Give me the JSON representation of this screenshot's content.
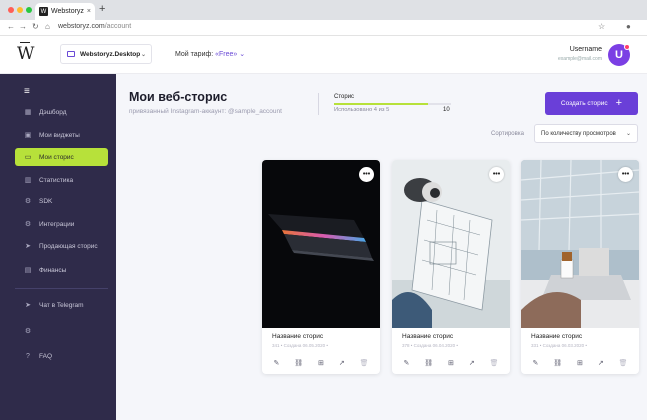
{
  "browser": {
    "tab_title": "Webstoryz",
    "tab_icon": "W",
    "tab_close": "×",
    "new_tab": "+",
    "url_domain": "webstoryz.com",
    "url_path": "/account",
    "traffic_lights": [
      "#ff5f57",
      "#febc2e",
      "#28c840"
    ]
  },
  "header": {
    "logo": "W",
    "project": "Webstoryz.Desktop",
    "plan_label": "Мой тариф:",
    "plan_value": "«Free»",
    "username": "Username",
    "email": "example@mail.com",
    "avatar_letter": "U"
  },
  "sidebar": {
    "items": [
      {
        "label": "Дэшборд",
        "icon": "grid-icon",
        "glyph": "▦",
        "active": false
      },
      {
        "label": "Мои виджеты",
        "icon": "widgets-icon",
        "glyph": "▣",
        "active": false
      },
      {
        "label": "Мои сторис",
        "icon": "stories-icon",
        "glyph": "▭",
        "active": true
      },
      {
        "label": "Статистика",
        "icon": "chart-icon",
        "glyph": "▥",
        "active": false
      },
      {
        "label": "SDK",
        "icon": "sdk-icon",
        "glyph": "⚙",
        "active": false
      },
      {
        "label": "Интеграции",
        "icon": "integrations-icon",
        "glyph": "⚙",
        "active": false
      },
      {
        "label": "Продающая сторис",
        "icon": "sell-icon",
        "glyph": "➤",
        "active": false
      },
      {
        "label": "Финансы",
        "icon": "finance-icon",
        "glyph": "▤",
        "active": false
      }
    ],
    "bottom_items": [
      {
        "label": "Чат в Telegram",
        "icon": "telegram-icon",
        "glyph": "➤"
      },
      {
        "label": "",
        "icon": "settings-icon",
        "glyph": "⚙"
      },
      {
        "label": "FAQ",
        "icon": "help-icon",
        "glyph": "?"
      }
    ]
  },
  "main": {
    "title": "Мои веб-сторис",
    "subtitle": "привязанный Instagram-аккаунт: @sample_account",
    "quota_label": "Сторис",
    "quota_used_text": "Использовано 4 из 5",
    "quota_total": "10",
    "quota_fraction": 0.8,
    "create_label": "Создать сторис",
    "create_plus": "+",
    "sort_label": "Сортировка",
    "sort_value": "По количеству просмотров"
  },
  "cards": [
    {
      "name": "Название сторис",
      "meta": "341 • Создана 06.05.2020 •",
      "more": "•••"
    },
    {
      "name": "Название сторис",
      "meta": "378 • Создана 06.04.2020 •",
      "more": "•••"
    },
    {
      "name": "Название сторис",
      "meta": "331 • Создана 06.03.2020 •",
      "more": "•••"
    }
  ],
  "colors": {
    "accent": "#6a3fd8",
    "active": "#b7e13a",
    "sidebar": "#2f2b4a"
  }
}
